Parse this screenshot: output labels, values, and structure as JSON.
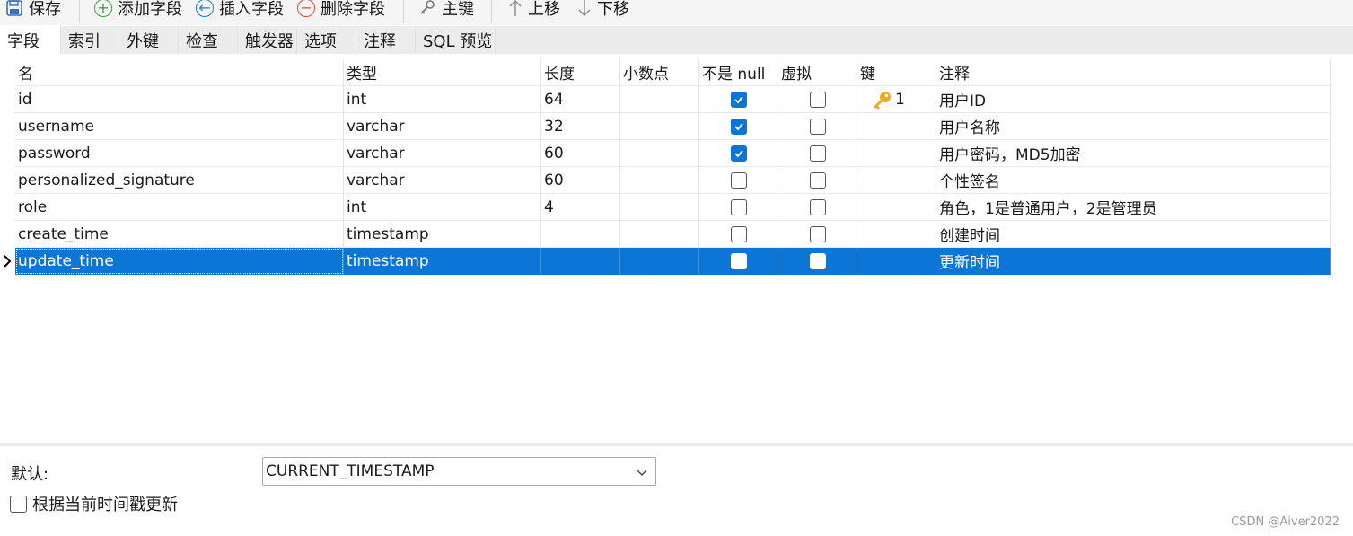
{
  "toolbar": {
    "save": "保存",
    "add_field": "添加字段",
    "insert_field": "插入字段",
    "delete_field": "删除字段",
    "primary_key": "主键",
    "move_up": "上移",
    "move_down": "下移"
  },
  "tabs": [
    "字段",
    "索引",
    "外键",
    "检查",
    "触发器",
    "选项",
    "注释",
    "SQL 预览"
  ],
  "active_tab": "字段",
  "columns": [
    "名",
    "类型",
    "长度",
    "小数点",
    "不是 null",
    "虚拟",
    "键",
    "注释"
  ],
  "rows": [
    {
      "name": "id",
      "type": "int",
      "length": "64",
      "decimals": "",
      "not_null": true,
      "virtual": false,
      "key": "1",
      "comment": "用户ID"
    },
    {
      "name": "username",
      "type": "varchar",
      "length": "32",
      "decimals": "",
      "not_null": true,
      "virtual": false,
      "key": "",
      "comment": "用户名称"
    },
    {
      "name": "password",
      "type": "varchar",
      "length": "60",
      "decimals": "",
      "not_null": true,
      "virtual": false,
      "key": "",
      "comment": "用户密码，MD5加密"
    },
    {
      "name": "personalized_signature",
      "type": "varchar",
      "length": "60",
      "decimals": "",
      "not_null": false,
      "virtual": false,
      "key": "",
      "comment": "个性签名"
    },
    {
      "name": "role",
      "type": "int",
      "length": "4",
      "decimals": "",
      "not_null": false,
      "virtual": false,
      "key": "",
      "comment": "角色，1是普通用户，2是管理员"
    },
    {
      "name": "create_time",
      "type": "timestamp",
      "length": "",
      "decimals": "",
      "not_null": false,
      "virtual": false,
      "key": "",
      "comment": "创建时间"
    },
    {
      "name": "update_time",
      "type": "timestamp",
      "length": "",
      "decimals": "",
      "not_null": false,
      "virtual": false,
      "key": "",
      "comment": "更新时间",
      "selected": true
    }
  ],
  "bottom": {
    "default_label": "默认:",
    "default_value": "CURRENT_TIMESTAMP",
    "update_label": "根据当前时间戳更新",
    "update_checked": false
  },
  "watermark": "CSDN @Aiver2022",
  "colors": {
    "selection": "#0c76d6",
    "checkbox_on": "#0c76d6",
    "key_icon": "#f0a81e"
  }
}
